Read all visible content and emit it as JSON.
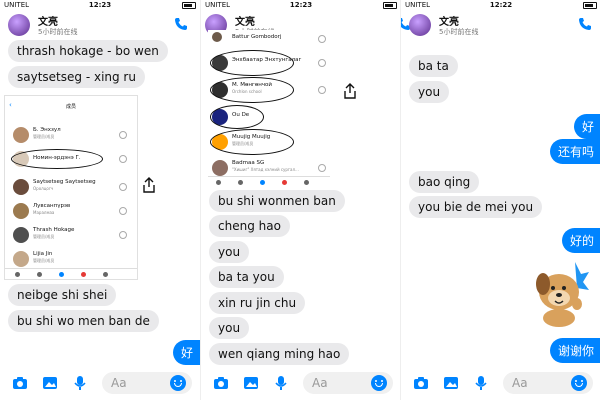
{
  "status": {
    "carrier": "UNITEL",
    "time_left": "12:23",
    "time_middle": "12:23",
    "time_right": "12:22"
  },
  "chat": {
    "contact_name": "文亮",
    "last_seen": "5小时前在线"
  },
  "panel1": {
    "messages_top": [
      "thrash hokage - bo wen",
      "saytsetseg - xing ru"
    ],
    "messages_bottom": [
      "neibge shi shei",
      "bu shi wo men ban de"
    ],
    "outgoing_partial": "好",
    "embedded": {
      "title": "成员",
      "members": [
        {
          "name": "Б. Энхзул",
          "sub": "管理员/成员",
          "sub2": "Aplas bi aj8daggun..."
        },
        {
          "name": "Номин-эрдэнэ Г.",
          "sub": ""
        },
        {
          "name": "Saytsetseg Saytsetseg",
          "sub": "Оролцогч"
        },
        {
          "name": "Лувсанпүрэв",
          "sub": "Маралмаа"
        },
        {
          "name": "Thrash Hokage",
          "sub": "管理员/成员",
          "sub2": "邀请者"
        },
        {
          "name": "Lijia Jin",
          "sub": "管理员/成员"
        }
      ]
    }
  },
  "panel2": {
    "embedded": {
      "members": [
        {
          "name": "Battur Gombodorj",
          "sub": ""
        },
        {
          "name": "Энхбаатар Энхтунгалаг",
          "sub": ""
        },
        {
          "name": "М. Мөнгөнчой",
          "sub": "Orchlon school"
        },
        {
          "name": "Ou De",
          "sub": ""
        },
        {
          "name": "Muujig Muujig",
          "sub": "管理员/成员"
        },
        {
          "name": "Badmaa SG",
          "sub": "\"Хишиг\" Хятад хэлний сургал..."
        }
      ]
    },
    "messages": [
      "bu shi wonmen ban",
      "cheng hao",
      "you",
      "ba ta you",
      "xin ru jin chu",
      "you",
      "wen qiang ming hao"
    ]
  },
  "panel3": {
    "top_partial": "…",
    "messages_in": [
      "ba ta",
      "you",
      "bao qing",
      "you bie de mei you"
    ],
    "messages_out": [
      "好",
      "还有吗",
      "好的",
      "谢谢你"
    ]
  },
  "input": {
    "placeholder": "Aa"
  },
  "colors": {
    "accent": "#0084ff",
    "bubble_in": "#e9e9eb"
  }
}
